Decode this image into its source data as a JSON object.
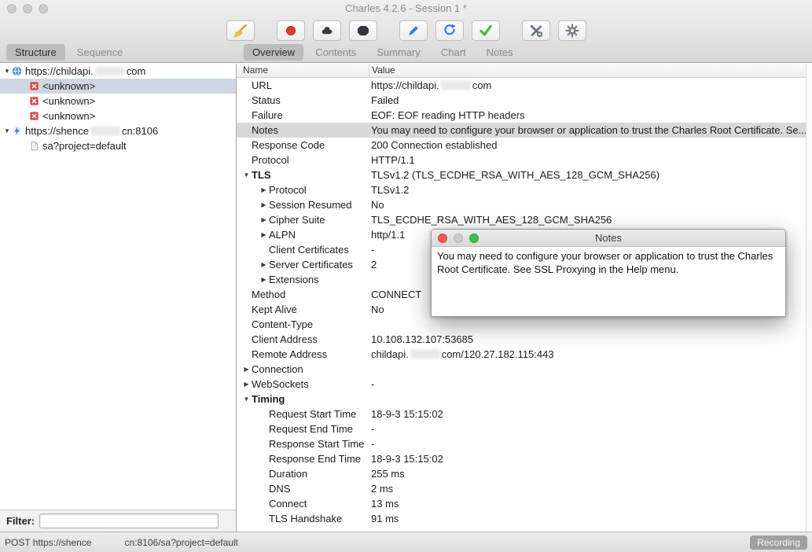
{
  "window": {
    "title": "Charles 4.2.6 - Session 1 *"
  },
  "toolbar": {
    "groups": [
      [
        {
          "name": "clear-session",
          "icon": "broom"
        }
      ],
      [
        {
          "name": "record",
          "icon": "record"
        },
        {
          "name": "throttling",
          "icon": "cloud"
        },
        {
          "name": "breakpoints",
          "icon": "breakpoint"
        }
      ],
      [
        {
          "name": "compose",
          "icon": "pencil"
        },
        {
          "name": "repeat",
          "icon": "refresh"
        },
        {
          "name": "validate",
          "icon": "check"
        }
      ],
      [
        {
          "name": "tools",
          "icon": "tools"
        },
        {
          "name": "settings",
          "icon": "gear"
        }
      ]
    ]
  },
  "left_tabs": [
    {
      "label": "Structure",
      "selected": true
    },
    {
      "label": "Sequence",
      "selected": false
    }
  ],
  "right_tabs": [
    {
      "label": "Overview",
      "selected": true
    },
    {
      "label": "Contents",
      "selected": false
    },
    {
      "label": "Summary",
      "selected": false
    },
    {
      "label": "Chart",
      "selected": false
    },
    {
      "label": "Notes",
      "selected": false
    }
  ],
  "sidebar": {
    "tree": [
      {
        "icon": "globe",
        "disclosure": "open",
        "indent": 0,
        "label_parts": [
          "https://childapi.",
          {
            "redacted": true
          },
          "com"
        ]
      },
      {
        "icon": "error",
        "indent": 1,
        "label": "<unknown>",
        "selected": true
      },
      {
        "icon": "error",
        "indent": 1,
        "label": "<unknown>"
      },
      {
        "icon": "error",
        "indent": 1,
        "label": "<unknown>"
      },
      {
        "icon": "bolt",
        "disclosure": "open",
        "indent": 0,
        "label_parts": [
          "https://shence",
          {
            "redacted": true
          },
          "cn:8106"
        ]
      },
      {
        "icon": "doc",
        "indent": 1,
        "label": "sa?project=default"
      }
    ],
    "filter_label": "Filter:",
    "filter_value": ""
  },
  "table": {
    "columns": [
      "Name",
      "Value"
    ],
    "rows": [
      {
        "name": "URL",
        "value_parts": [
          "https://childapi.",
          {
            "redacted": true
          },
          "com"
        ]
      },
      {
        "name": "Status",
        "value": "Failed"
      },
      {
        "name": "Failure",
        "value": "EOF: EOF reading HTTP headers"
      },
      {
        "name": "Notes",
        "value": "You may need to configure your browser or application to trust the Charles Root Certificate. Se...",
        "selected": true
      },
      {
        "name": "Response Code",
        "value": "200 Connection established"
      },
      {
        "name": "Protocol",
        "value": "HTTP/1.1"
      },
      {
        "name": "TLS",
        "value": "TLSv1.2 (TLS_ECDHE_RSA_WITH_AES_128_GCM_SHA256)",
        "disclosure": "open",
        "bold": true
      },
      {
        "name": "Protocol",
        "value": "TLSv1.2",
        "disclosure": "closed",
        "indent": 1
      },
      {
        "name": "Session Resumed",
        "value": "No",
        "disclosure": "closed",
        "indent": 1
      },
      {
        "name": "Cipher Suite",
        "value": "TLS_ECDHE_RSA_WITH_AES_128_GCM_SHA256",
        "disclosure": "closed",
        "indent": 1
      },
      {
        "name": "ALPN",
        "value": "http/1.1",
        "disclosure": "closed",
        "indent": 1
      },
      {
        "name": "Client Certificates",
        "value": "-",
        "indent": 1
      },
      {
        "name": "Server Certificates",
        "value": "2",
        "disclosure": "closed",
        "indent": 1
      },
      {
        "name": "Extensions",
        "value": "",
        "disclosure": "closed",
        "indent": 1
      },
      {
        "name": "Method",
        "value": "CONNECT"
      },
      {
        "name": "Kept Alive",
        "value": "No"
      },
      {
        "name": "Content-Type",
        "value": ""
      },
      {
        "name": "Client Address",
        "value": "10.108.132.107:53685"
      },
      {
        "name": "Remote Address",
        "value_parts": [
          "childapi.",
          {
            "redacted": true
          },
          "com/120.27.182.115:443"
        ]
      },
      {
        "name": "Connection",
        "value": "",
        "disclosure": "closed"
      },
      {
        "name": "WebSockets",
        "value": "-",
        "disclosure": "closed"
      },
      {
        "name": "Timing",
        "value": "",
        "disclosure": "open",
        "bold": true
      },
      {
        "name": "Request Start Time",
        "value": "18-9-3 15:15:02",
        "indent": 1
      },
      {
        "name": "Request End Time",
        "value": "-",
        "indent": 1
      },
      {
        "name": "Response Start Time",
        "value": "-",
        "indent": 1
      },
      {
        "name": "Response End Time",
        "value": "18-9-3 15:15:02",
        "indent": 1
      },
      {
        "name": "Duration",
        "value": "255 ms",
        "indent": 1
      },
      {
        "name": "DNS",
        "value": "2 ms",
        "indent": 1
      },
      {
        "name": "Connect",
        "value": "13 ms",
        "indent": 1
      },
      {
        "name": "TLS Handshake",
        "value": "91 ms",
        "indent": 1
      }
    ]
  },
  "popup": {
    "title": "Notes",
    "body": "You may need to configure your browser or application to trust the Charles Root Certificate. See SSL Proxying in the Help menu."
  },
  "statusbar": {
    "text_parts": [
      "POST https://shence",
      {
        "redacted": true
      },
      "cn:8106/sa?project=default"
    ],
    "recording_label": "Recording"
  }
}
